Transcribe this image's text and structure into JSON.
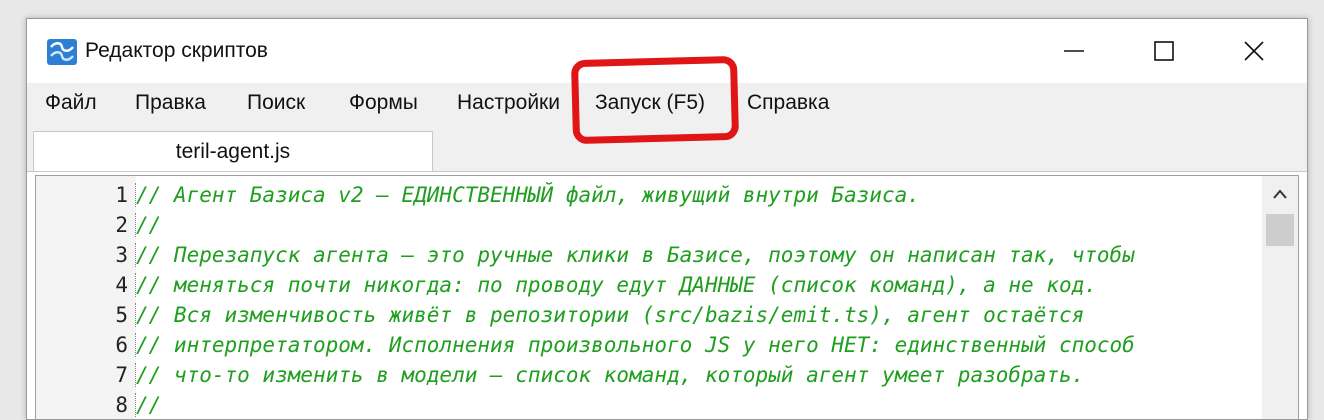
{
  "window": {
    "title": "Редактор скриптов",
    "app_icon": "app-icon"
  },
  "menu": {
    "items": [
      "Файл",
      "Правка",
      "Поиск",
      "Формы",
      "Настройки",
      "Запуск (F5)",
      "Справка"
    ]
  },
  "tabs": [
    {
      "label": "teril-agent.js",
      "active": true
    }
  ],
  "editor": {
    "lines": [
      {
        "num": "1",
        "text": "// Агент Базиса v2 — ЕДИНСТВЕННЫЙ файл, живущий внутри Базиса."
      },
      {
        "num": "2",
        "text": "//"
      },
      {
        "num": "3",
        "text": "// Перезапуск агента — это ручные клики в Базисе, поэтому он написан так, чтобы"
      },
      {
        "num": "4",
        "text": "// меняться почти никогда: по проводу едут ДАННЫЕ (список команд), а не код."
      },
      {
        "num": "5",
        "text": "// Вся изменчивость живёт в репозитории (src/bazis/emit.ts), агент остаётся"
      },
      {
        "num": "6",
        "text": "// интерпретатором. Исполнения произвольного JS у него НЕТ: единственный способ"
      },
      {
        "num": "7",
        "text": "// что-то изменить в модели — список команд, который агент умеет разобрать."
      },
      {
        "num": "8",
        "text": "//"
      }
    ],
    "comment_color": "#1f9e1f"
  },
  "annotation": {
    "color": "#e01515",
    "target": "Запуск (F5)"
  }
}
